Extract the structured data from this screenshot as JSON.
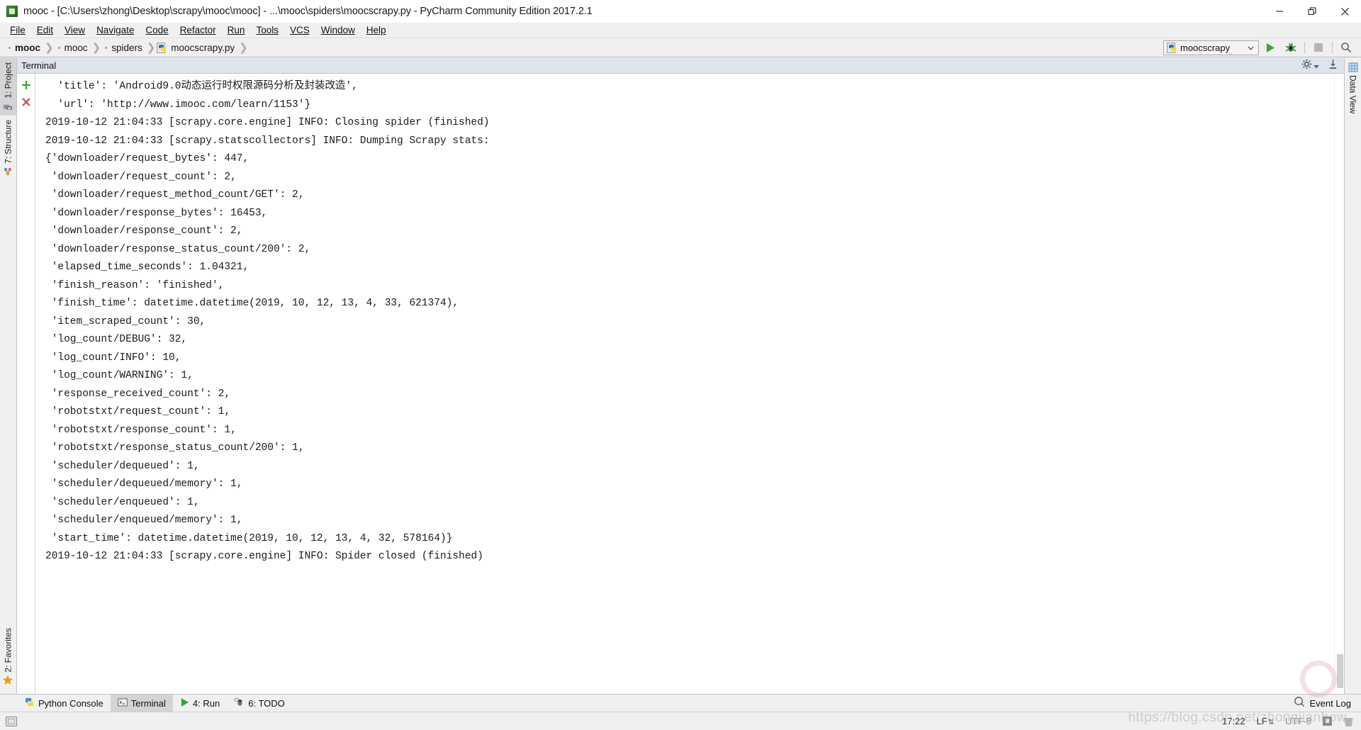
{
  "window": {
    "title": "mooc - [C:\\Users\\zhong\\Desktop\\scrapy\\mooc\\mooc] - ...\\mooc\\spiders\\moocscrapy.py - PyCharm Community Edition 2017.2.1",
    "app_icon": "pycharm-icon",
    "controls": {
      "minimize": "minimize-icon",
      "restore": "restore-icon",
      "close": "close-icon"
    }
  },
  "menubar": {
    "items": [
      {
        "label": "File",
        "mnemonic": "F"
      },
      {
        "label": "Edit",
        "mnemonic": "E"
      },
      {
        "label": "View",
        "mnemonic": "V"
      },
      {
        "label": "Navigate",
        "mnemonic": "N"
      },
      {
        "label": "Code",
        "mnemonic": "C"
      },
      {
        "label": "Refactor",
        "mnemonic": "R"
      },
      {
        "label": "Run",
        "mnemonic": "u"
      },
      {
        "label": "Tools",
        "mnemonic": "T"
      },
      {
        "label": "VCS",
        "mnemonic": "S"
      },
      {
        "label": "Window",
        "mnemonic": "W"
      },
      {
        "label": "Help",
        "mnemonic": "H"
      }
    ]
  },
  "breadcrumb": {
    "items": [
      {
        "label": "mooc",
        "bold": true,
        "icon": ""
      },
      {
        "label": "mooc",
        "bold": false,
        "icon": ""
      },
      {
        "label": "spiders",
        "bold": false,
        "icon": ""
      },
      {
        "label": "moocscrapy.py",
        "bold": false,
        "icon": "python-file-icon"
      }
    ]
  },
  "toolbar": {
    "run_config": {
      "label": "moocscrapy",
      "icon": "python-config-icon",
      "chevron": "chevron-down-icon"
    },
    "run_button": "run-icon",
    "debug_button": "debug-icon",
    "stop_button": "stop-icon",
    "search_button": "search-icon"
  },
  "left_strip": {
    "items": [
      {
        "label": "1: Project",
        "icon": "project-icon",
        "active": true
      },
      {
        "label": "7: Structure",
        "icon": "structure-icon",
        "active": false
      },
      {
        "label": "2: Favorites",
        "icon": "star-icon",
        "active": false
      }
    ]
  },
  "right_strip": {
    "items": [
      {
        "label": "Data View",
        "icon": "grid-icon",
        "active": false
      }
    ]
  },
  "terminal": {
    "title": "Terminal",
    "new_session": "plus-icon",
    "close_session": "close-x-icon",
    "settings": "gear-icon",
    "settings_chevron": "chevron-down-icon",
    "scroll_to_end": "scroll-to-end-icon",
    "lines": [
      "  'title': 'Android9.0动态运行时权限源码分析及封装改造',",
      "  'url': 'http://www.imooc.com/learn/1153'}",
      "2019-10-12 21:04:33 [scrapy.core.engine] INFO: Closing spider (finished)",
      "2019-10-12 21:04:33 [scrapy.statscollectors] INFO: Dumping Scrapy stats:",
      "{'downloader/request_bytes': 447,",
      " 'downloader/request_count': 2,",
      " 'downloader/request_method_count/GET': 2,",
      " 'downloader/response_bytes': 16453,",
      " 'downloader/response_count': 2,",
      " 'downloader/response_status_count/200': 2,",
      " 'elapsed_time_seconds': 1.04321,",
      " 'finish_reason': 'finished',",
      " 'finish_time': datetime.datetime(2019, 10, 12, 13, 4, 33, 621374),",
      " 'item_scraped_count': 30,",
      " 'log_count/DEBUG': 32,",
      " 'log_count/INFO': 10,",
      " 'log_count/WARNING': 1,",
      " 'response_received_count': 2,",
      " 'robotstxt/request_count': 1,",
      " 'robotstxt/response_count': 1,",
      " 'robotstxt/response_status_count/200': 1,",
      " 'scheduler/dequeued': 1,",
      " 'scheduler/dequeued/memory': 1,",
      " 'scheduler/enqueued': 1,",
      " 'scheduler/enqueued/memory': 1,",
      " 'start_time': datetime.datetime(2019, 10, 12, 13, 4, 32, 578164)}",
      "2019-10-12 21:04:33 [scrapy.core.engine] INFO: Spider closed (finished)"
    ]
  },
  "toolwindow_bar": {
    "items": [
      {
        "label": "Python Console",
        "icon": "python-console-icon",
        "active": false,
        "mnemonic": ""
      },
      {
        "label": "Terminal",
        "icon": "terminal-icon",
        "active": true,
        "mnemonic": ""
      },
      {
        "label": "4: Run",
        "icon": "run-icon",
        "active": false,
        "mnemonic": "4"
      },
      {
        "label": "6: TODO",
        "icon": "todo-icon",
        "active": false,
        "mnemonic": "6"
      }
    ],
    "event_log": {
      "label": "Event Log",
      "icon": "event-log-icon"
    }
  },
  "statusbar": {
    "memory_indicator": "memory-indicator",
    "time": "17:22",
    "line_separator": "LF",
    "encoding": "UTF-8",
    "lock": "lock-icon",
    "trash": "trash-icon"
  },
  "watermark": {
    "text": "https://blog.csdn.net/zhongjianbow"
  },
  "colors": {
    "accent_green": "#3aa33a",
    "accent_red": "#cc5555",
    "terminal_header": "#dfe3ec",
    "chrome": "#f0f0f0"
  }
}
